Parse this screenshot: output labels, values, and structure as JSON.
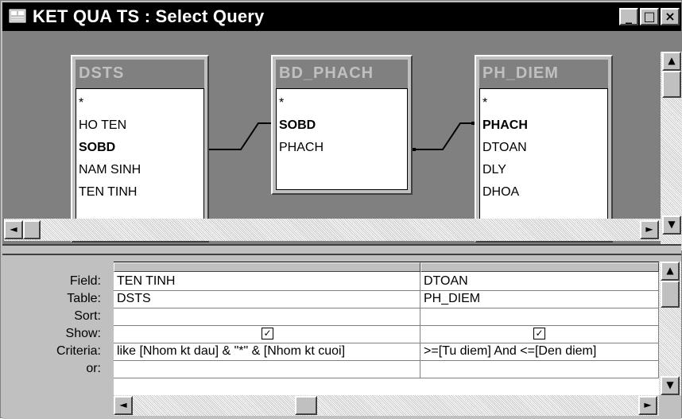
{
  "window": {
    "title": "KET QUA TS : Select Query",
    "controls": {
      "minimize": "_",
      "maximize": "□",
      "close": "×"
    }
  },
  "tables": [
    {
      "name": "DSTS",
      "fields": [
        "*",
        "HO TEN",
        "SOBD",
        "NAM SINH",
        "TEN TINH"
      ],
      "key_field": "SOBD"
    },
    {
      "name": "BD_PHACH",
      "fields": [
        "*",
        "SOBD",
        "PHACH"
      ],
      "key_field": "SOBD"
    },
    {
      "name": "PH_DIEM",
      "fields": [
        "*",
        "PHACH",
        "DTOAN",
        "DLY",
        "DHOA"
      ],
      "key_field": "PHACH"
    }
  ],
  "grid": {
    "row_labels": [
      "Field:",
      "Table:",
      "Sort:",
      "Show:",
      "Criteria:",
      "or:"
    ],
    "columns": [
      {
        "field": "TEN TINH",
        "table": "DSTS",
        "sort": "",
        "show": true,
        "criteria": "like [Nhom kt dau] & \"*\" & [Nhom kt cuoi]",
        "or": ""
      },
      {
        "field": "DTOAN",
        "table": "PH_DIEM",
        "sort": "",
        "show": true,
        "criteria": ">=[Tu diem] And <=[Den diem]",
        "or": ""
      }
    ],
    "check_glyph": "✓"
  },
  "icons": {
    "app": "query-window-icon",
    "scroll_up": "▲",
    "scroll_down": "▼",
    "scroll_left": "◄",
    "scroll_right": "►"
  },
  "colors": {
    "title_bar": "#000000",
    "window_face": "#c0c0c0",
    "designer_bg": "#808080",
    "table_header": "#808080"
  }
}
